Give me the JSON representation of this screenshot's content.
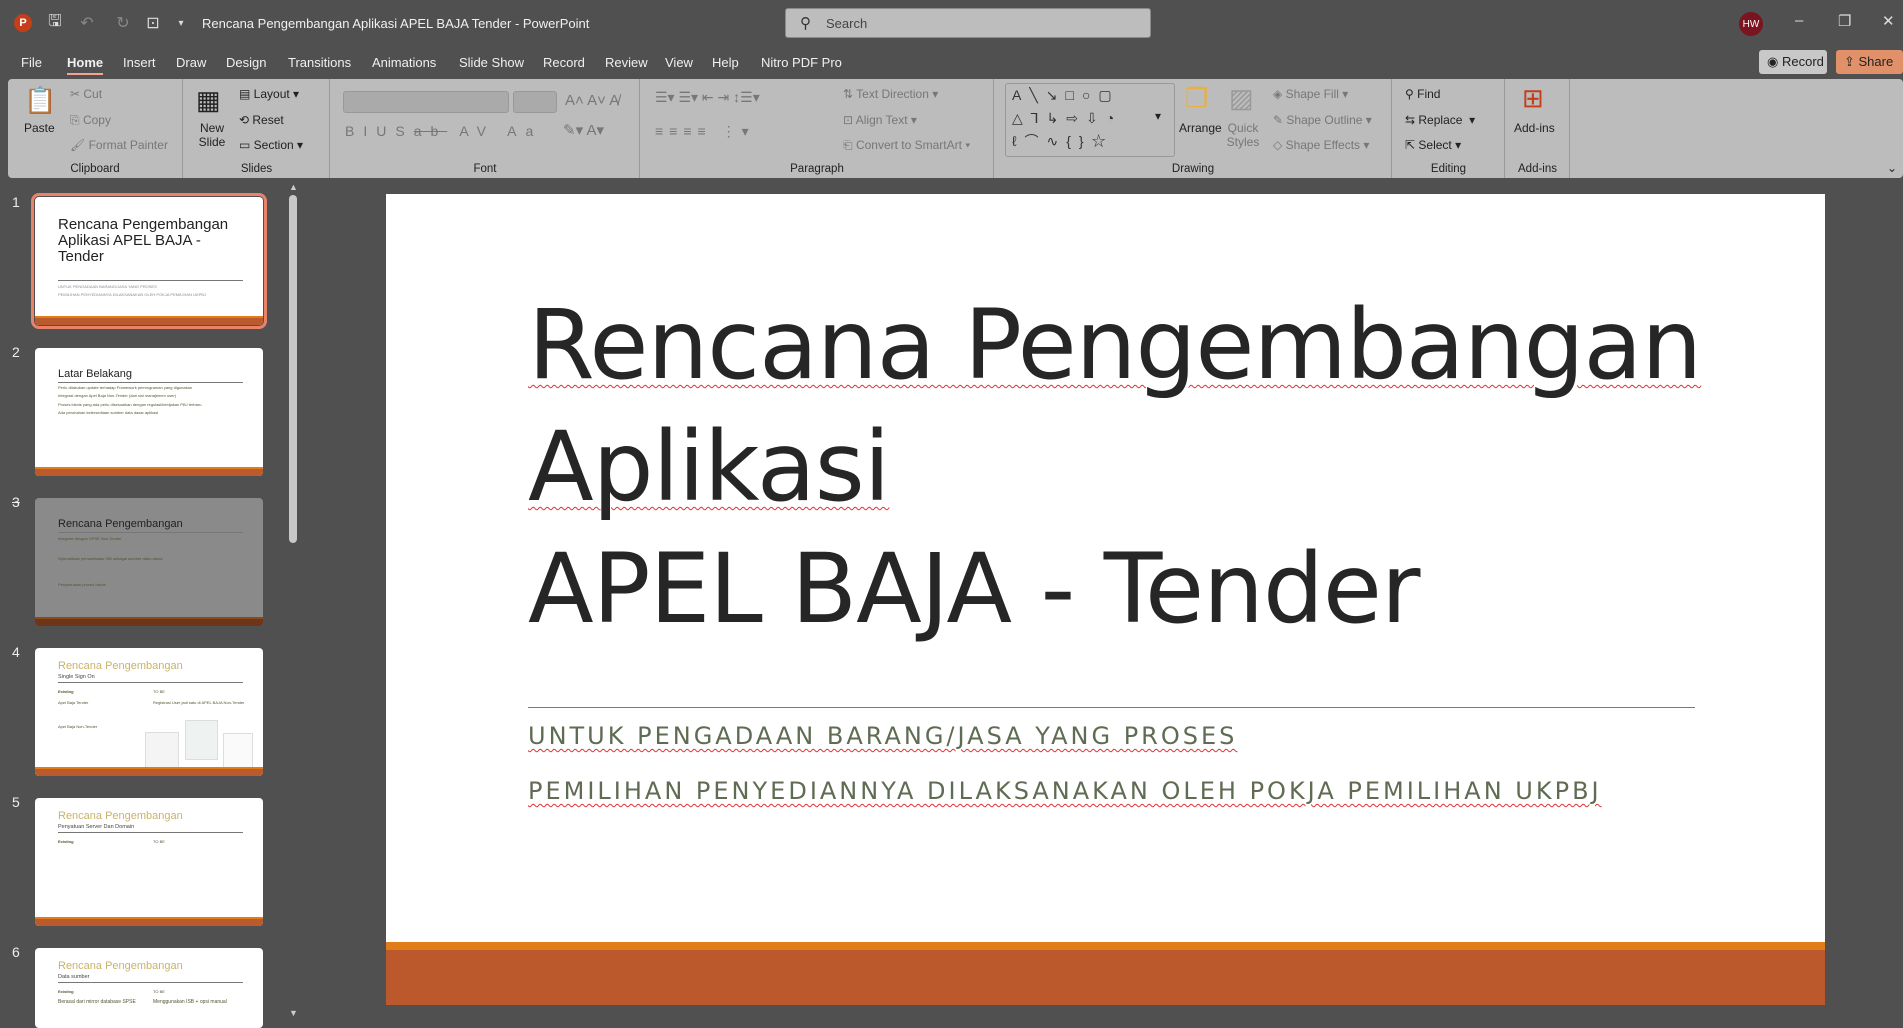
{
  "titlebar": {
    "app_icon": "P",
    "title": "Rencana Pengembangan Aplikasi APEL BAJA Tender  -  PowerPoint",
    "search_placeholder": "Search",
    "avatar": "HW"
  },
  "menu": {
    "tabs": [
      "File",
      "Home",
      "Insert",
      "Draw",
      "Design",
      "Transitions",
      "Animations",
      "Slide Show",
      "Record",
      "Review",
      "View",
      "Help",
      "Nitro PDF Pro"
    ],
    "record": "Record",
    "share": "Share"
  },
  "ribbon": {
    "clipboard": {
      "paste": "Paste",
      "cut": "Cut",
      "copy": "Copy",
      "format_painter": "Format Painter",
      "label": "Clipboard"
    },
    "slides": {
      "new_slide": "New Slide",
      "layout": "Layout",
      "reset": "Reset",
      "section": "Section",
      "label": "Slides"
    },
    "font": {
      "label": "Font"
    },
    "paragraph": {
      "text_direction": "Text Direction",
      "align_text": "Align Text",
      "convert": "Convert to SmartArt",
      "label": "Paragraph"
    },
    "drawing": {
      "arrange": "Arrange",
      "quick_styles": "Quick Styles",
      "shape_fill": "Shape Fill",
      "shape_outline": "Shape Outline",
      "shape_effects": "Shape Effects",
      "label": "Drawing"
    },
    "editing": {
      "find": "Find",
      "replace": "Replace",
      "select": "Select",
      "label": "Editing"
    },
    "addins": {
      "addins": "Add-ins",
      "label": "Add-ins"
    }
  },
  "thumbnails": [
    {
      "num": "1",
      "title": "Rencana Pengembangan Aplikasi APEL BAJA - Tender",
      "lines": [
        "UNTUK PENGADAAN BARANG/JASA YANG PROSES",
        "PEMILIHAN PENYEDIANNYA DILAKSANAKAN OLEH POKJA PEMILIHAN UKPBJ"
      ]
    },
    {
      "num": "2",
      "title": "Latar Belakang",
      "lines": [
        "Perlu dilakukan update terhadap Framework pemrograman yang digunakan",
        "Integrasi dengan Apel Baja Non-Tender (dari sisi manajemen user)",
        "Proses bisnis yang ada perlu disesuaikan dengan regulasi/kebijakan PBJ terbaru",
        "Ada perubahan ketersediaan sumber data dasar aplikasi"
      ]
    },
    {
      "num": "3",
      "title": "Rencana Pengembangan",
      "lines": [
        "Integrasi dengan SPSE Non-Tender",
        "Optimalisasi pemanfaatan ISB sebagai sumber data utama",
        "Penyesuaian proses bisnis"
      ]
    },
    {
      "num": "4",
      "title": "Rencana Pengembangan",
      "subtitle": "Single Sign On",
      "lines": [
        "Existing",
        "TO BE",
        "Apel Baja Tender",
        "Registrasi User jadi satu di APEL BAJA Non-Tender",
        "Apel Baja Non-Tender"
      ]
    },
    {
      "num": "5",
      "title": "Rencana Pengembangan",
      "subtitle": "Penyatuan Server Dan Domain",
      "lines": [
        "Existing",
        "TO BE"
      ]
    },
    {
      "num": "6",
      "title": "Rencana Pengembangan",
      "subtitle": "Data sumber",
      "lines": [
        "Existing",
        "TO BE",
        "Berasal dari mirror database SPSE",
        "Menggunakan ISB + opsi manual"
      ]
    }
  ],
  "slide": {
    "title_lines": [
      "Rencana Pengembangan",
      "Aplikasi",
      "APEL BAJA - Tender"
    ],
    "subtitle_lines": [
      "UNTUK PENGADAAN BARANG/JASA YANG PROSES",
      "PEMILIHAN PENYEDIANNYA DILAKSANAKAN OLEH POKJA PEMILIHAN UKPBJ"
    ]
  },
  "colors": {
    "accent": "#bb582c",
    "orange": "#e07c1a",
    "subtitle": "#5f6b52"
  }
}
